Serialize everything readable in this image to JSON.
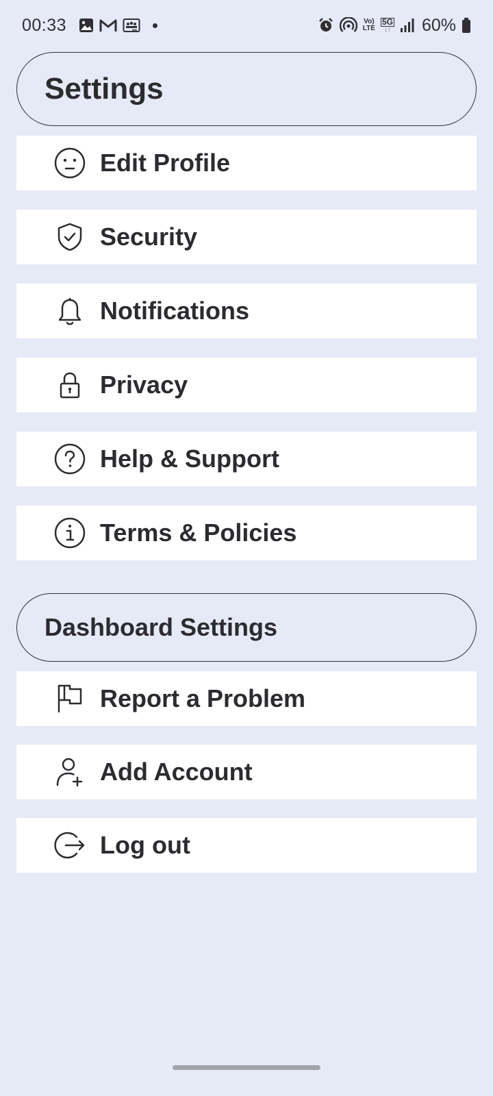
{
  "status_bar": {
    "time": "00:33",
    "volte_top": "Vo)",
    "volte_bottom": "LTE",
    "network_type": "5G",
    "battery": "60%"
  },
  "header": {
    "title": "Settings"
  },
  "main_items": [
    {
      "label": "Edit Profile",
      "icon": "face-icon"
    },
    {
      "label": "Security",
      "icon": "shield-check-icon"
    },
    {
      "label": "Notifications",
      "icon": "bell-icon"
    },
    {
      "label": "Privacy",
      "icon": "lock-icon"
    },
    {
      "label": "Help & Support",
      "icon": "help-circle-icon"
    },
    {
      "label": "Terms & Policies",
      "icon": "info-circle-icon"
    }
  ],
  "dashboard": {
    "title": "Dashboard Settings",
    "items": [
      {
        "label": "Report a Problem",
        "icon": "flag-icon"
      },
      {
        "label": "Add Account",
        "icon": "add-user-icon"
      },
      {
        "label": "Log out",
        "icon": "logout-icon"
      }
    ]
  },
  "colors": {
    "background": "#e6e9f6",
    "row_background": "#ffffff",
    "text": "#2b2b30"
  }
}
